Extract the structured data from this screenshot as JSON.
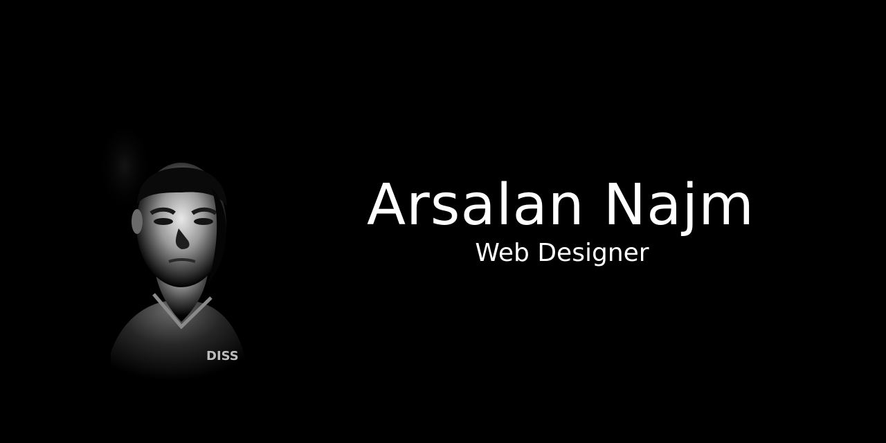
{
  "banner": {
    "name": "Arsalan Najm",
    "role": "Web Designer",
    "shirt_text": "DISS"
  },
  "colors": {
    "background": "#000000",
    "text": "#ffffff"
  }
}
